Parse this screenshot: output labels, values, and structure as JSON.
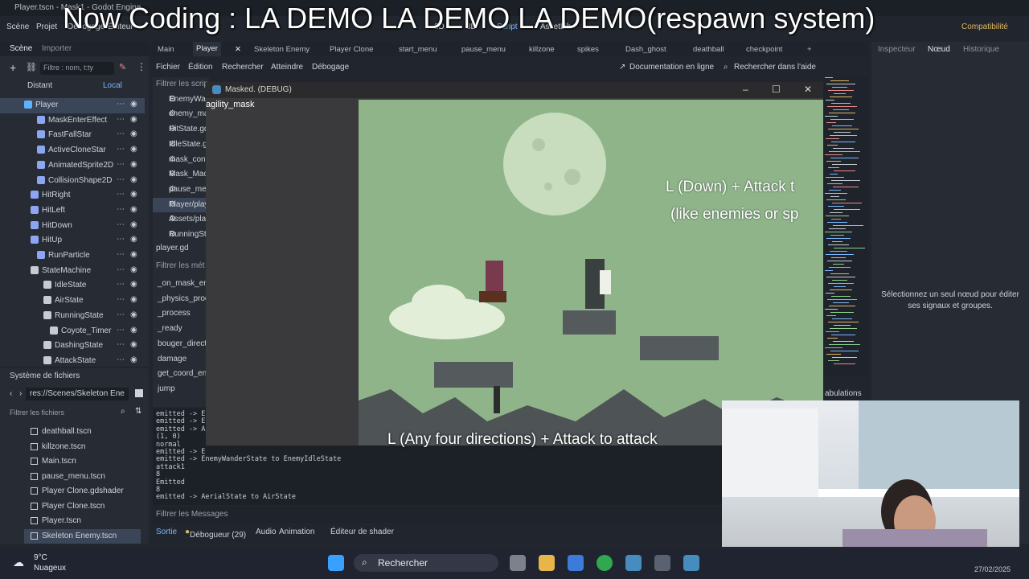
{
  "window": {
    "title": "Player.tscn - Mask1 - Godot Engine"
  },
  "overlay_title": "Now Coding : LA DEMO LA DEMO LA DEMO(respawn system)",
  "menu": {
    "scene": "Scène",
    "project": "Projet",
    "debug": "Débogage",
    "editor": "Éditeur",
    "mode_2d": "2D",
    "mode_3d": "3D",
    "script": "Script",
    "assetlib": "AssetLib",
    "compat": "Compatibilité"
  },
  "scene_dock": {
    "tab_scene": "Scène",
    "tab_import": "Importer",
    "filter_placeholder": "Filtre : nom, t:ty",
    "remote": "Distant",
    "local": "Local",
    "nodes": [
      {
        "label": "Player",
        "color": "#5fb2ff"
      },
      {
        "label": "MaskEnterEffect",
        "color": "#8da5f3"
      },
      {
        "label": "FastFallStar",
        "color": "#8da5f3"
      },
      {
        "label": "ActiveCloneStar",
        "color": "#8da5f3"
      },
      {
        "label": "AnimatedSprite2D",
        "color": "#8da5f3"
      },
      {
        "label": "CollisionShape2D",
        "color": "#8da5f3"
      },
      {
        "label": "HitRight",
        "color": "#8da5f3"
      },
      {
        "label": "HitLeft",
        "color": "#8da5f3"
      },
      {
        "label": "HitDown",
        "color": "#8da5f3"
      },
      {
        "label": "HitUp",
        "color": "#8da5f3"
      },
      {
        "label": "RunParticle",
        "color": "#8da5f3"
      },
      {
        "label": "StateMachine",
        "color": "#c7ccd4"
      },
      {
        "label": "IdleState",
        "color": "#c7ccd4"
      },
      {
        "label": "AirState",
        "color": "#c7ccd4"
      },
      {
        "label": "RunningState",
        "color": "#c7ccd4"
      },
      {
        "label": "Coyote_Timer",
        "color": "#c7ccd4"
      },
      {
        "label": "DashingState",
        "color": "#c7ccd4"
      },
      {
        "label": "AttackState",
        "color": "#c7ccd4"
      }
    ]
  },
  "filesystem": {
    "title": "Système de fichiers",
    "path": "res://Scenes/Skeleton Ene",
    "filter_placeholder": "Filtrer les fichiers",
    "files": [
      "deathball.tscn",
      "killzone.tscn",
      "Main.tscn",
      "pause_menu.tscn",
      "Player Clone.gdshader",
      "Player Clone.tscn",
      "Player.tscn",
      "Skeleton Enemy.tscn"
    ]
  },
  "editor_tabs": [
    "Main",
    "Player",
    "Skeleton Enemy",
    "Player Clone",
    "start_menu",
    "pause_menu",
    "killzone",
    "spikes",
    "Dash_ghost",
    "deathball",
    "checkpoint"
  ],
  "script_menu": {
    "file": "Fichier",
    "edit": "Édition",
    "search": "Rechercher",
    "goto": "Atteindre",
    "debug": "Débogage",
    "online_docs": "Documentation en ligne",
    "search_help": "Rechercher dans l'aide"
  },
  "script_list": {
    "filter_placeholder": "Filtrer les scrip",
    "scripts": [
      "EnemyWan",
      "enemy_ma",
      "HitState.gd",
      "IdleState.g",
      "mask_cont",
      "Mask_Mac",
      "pause_me",
      "Player/play",
      "Assets/pla",
      "RunningSt"
    ],
    "current": "player.gd",
    "methods_filter": "Filtrer les mét",
    "methods": [
      "_on_mask_ent",
      "_physics_proc",
      "_process",
      "_ready",
      "bouger_direct",
      "damage",
      "get_coord_en",
      "jump"
    ]
  },
  "console": {
    "lines": [
      "emitted -> E",
      "emitted -> E",
      "emitted -> A",
      "(1, 0)",
      "normal",
      "emitted -> E",
      "emitted -> EnemyWanderState to EnemyIdleState",
      "attack1",
      "8",
      "Emitted",
      "8",
      "emitted -> AerialState to AirState"
    ],
    "filter": "Filtrer les Messages"
  },
  "bottom_tabs": {
    "output": "Sortie",
    "debugger": "Débogueur (29)",
    "audio": "Audio",
    "animation": "Animation",
    "shader": "Éditeur de shader"
  },
  "tabulations": "abulations",
  "inspector": {
    "tab_inspector": "Inspecteur",
    "tab_node": "Nœud",
    "tab_history": "Historique",
    "message": "Sélectionnez un seul nœud pour éditer ses signaux et groupes."
  },
  "game": {
    "title": "Masked. (DEBUG)",
    "agility": "agility_mask",
    "hint_1": "L (Down) + Attack t",
    "hint_2": "(like enemies or sp",
    "hint_bottom": "L (Any four directions) + Attack to attack"
  },
  "taskbar": {
    "temp": "9°C",
    "weather": "Nuageux",
    "search": "Rechercher",
    "date": "27/02/2025"
  }
}
